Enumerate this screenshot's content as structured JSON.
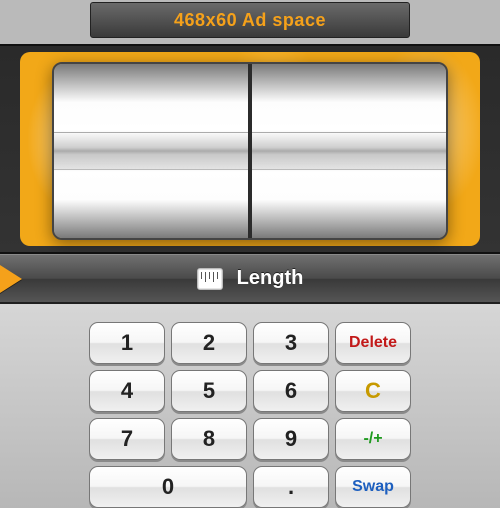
{
  "ad": {
    "label": "468x60 Ad space"
  },
  "category": {
    "label": "Length"
  },
  "keypad": {
    "k1": "1",
    "k2": "2",
    "k3": "3",
    "k4": "4",
    "k5": "5",
    "k6": "6",
    "k7": "7",
    "k8": "8",
    "k9": "9",
    "k0": "0",
    "kdot": ".",
    "delete": "Delete",
    "clear": "C",
    "sign": "-/+",
    "swap": "Swap"
  }
}
